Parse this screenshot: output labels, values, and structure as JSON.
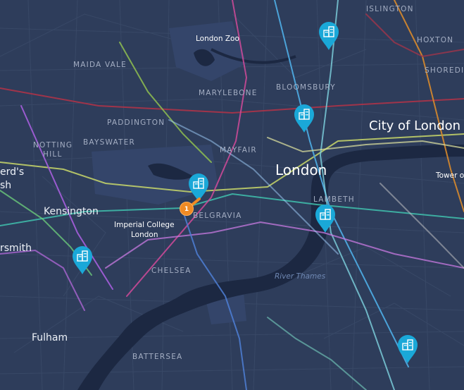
{
  "map": {
    "colors": {
      "land": "#2e3d5b",
      "water": "#1c2842",
      "roads": "#3c4c6b",
      "pin": "#1aa8d8",
      "cluster": "#f08a24"
    },
    "labels": {
      "islington": "ISLINGTON",
      "hoxton": "HOXTON",
      "shoreditch": "SHOREDI",
      "london_zoo": "London Zoo",
      "maida_vale": "MAIDA VALE",
      "marylebone": "MARYLEBONE",
      "bloomsbury": "BLOOMSBURY",
      "paddington": "PADDINGTON",
      "notting_hill_1": "NOTTING",
      "notting_hill_2": "HILL",
      "bayswater": "BAYSWATER",
      "city_of_london": "City of London",
      "mayfair": "MAYFAIR",
      "london": "London",
      "shepherds_bush_1": "erd's",
      "shepherds_bush_2": "sh",
      "tower": "Tower o",
      "kensington": "Kensington",
      "belgravia": "BELGRAVIA",
      "lambeth": "LAMBETH",
      "imperial_1": "Imperial College",
      "imperial_2": "London",
      "hammersmith": "rsmith",
      "chelsea": "CHELSEA",
      "river_thames": "River Thames",
      "fulham": "Fulham",
      "battersea": "BATTERSEA"
    },
    "markers": {
      "cluster_count": "1",
      "pin_icon": "building-icon"
    }
  }
}
